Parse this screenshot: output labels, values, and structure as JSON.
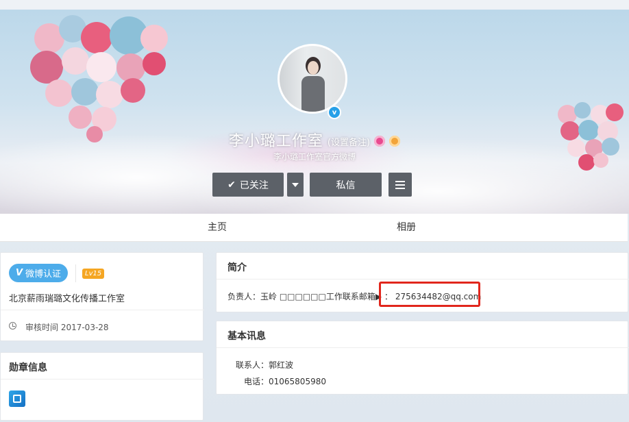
{
  "profile": {
    "name": "李小璐工作室",
    "remark_link": "(设置备注)",
    "description": "李小璐工作室官方微博",
    "verified_icon": "v-verified-icon",
    "badges": [
      "pink-badge-icon",
      "gold-badge-icon"
    ]
  },
  "actions": {
    "follow_label": "已关注",
    "message_label": "私信"
  },
  "nav": {
    "tabs": [
      "主页",
      "相册"
    ]
  },
  "verification": {
    "pill_label": "微博认证",
    "level": "Lv15",
    "org_name": "北京薪雨瑞璐文化传播工作室",
    "review_time": "审核时间 2017-03-28"
  },
  "medals": {
    "title": "勋章信息"
  },
  "intro": {
    "title": "简介",
    "text": "负责人：玉岭 □□□□□□工作联系邮箱▶ ：",
    "email": "275634482@qq.com"
  },
  "basic_info": {
    "title": "基本讯息",
    "contact": "联系人：郭红波",
    "phone": "电话：01065805980"
  },
  "colors": {
    "button_bg": "#5c6168",
    "verify_blue": "#4dacea",
    "level_orange": "#f5a623",
    "highlight_red": "#e1261c"
  }
}
